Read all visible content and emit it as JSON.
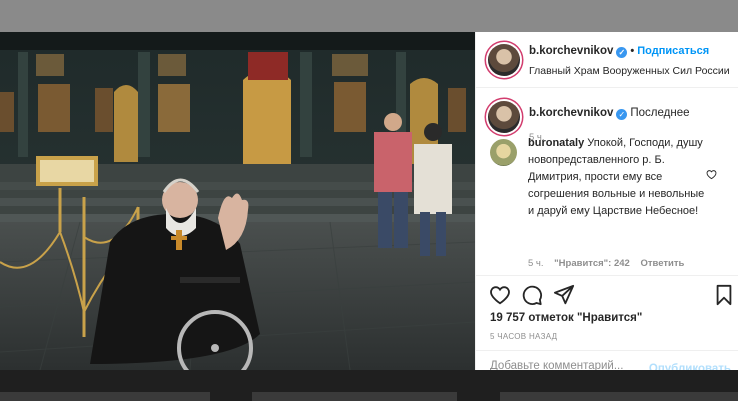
{
  "post": {
    "username": "b.korchevnikov",
    "follow_label": "Подписаться",
    "location": "Главный Храм Вооруженных Сил России",
    "caption_text": "Последнее",
    "caption_time": "5 ч.",
    "likes": "19 757 отметок \"Нравится\"",
    "date": "5 ЧАСОВ НАЗАД"
  },
  "comment": {
    "username": "buronataly",
    "text": "Упокой, Господи, душу новопредставленного р. Б. Димитрия, прости ему все согрешения вольные и невольные и даруй ему Царствие Небесное!",
    "time": "5 ч.",
    "likes": "\"Нравится\": 242",
    "reply": "Ответить"
  },
  "add_comment": {
    "placeholder": "Добавьте комментарий...",
    "publish_label": "Опубликовать"
  },
  "colors": {
    "accent": "#0095f6",
    "verified": "#3897f0",
    "story_ring": "#d23d6e"
  },
  "icons": [
    "heart-icon",
    "comment-icon",
    "share-icon",
    "bookmark-icon",
    "verified-icon"
  ]
}
